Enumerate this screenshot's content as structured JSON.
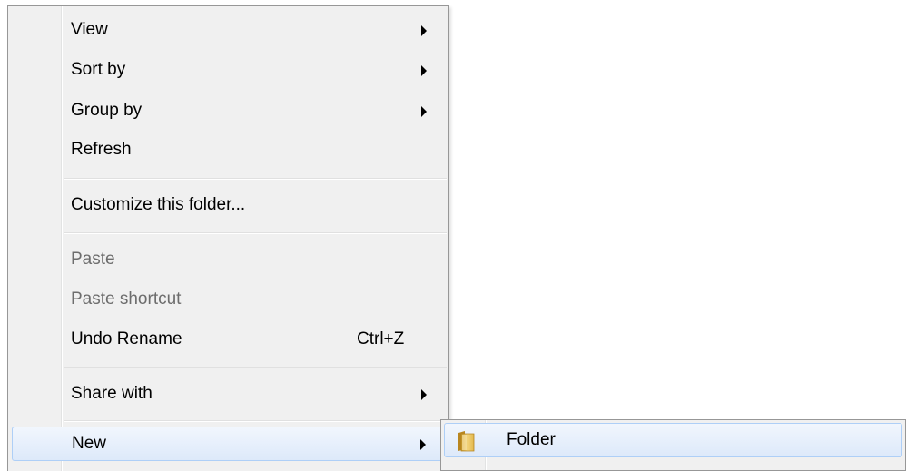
{
  "context_menu": {
    "items": [
      {
        "label": "View",
        "has_submenu": true
      },
      {
        "label": "Sort by",
        "has_submenu": true
      },
      {
        "label": "Group by",
        "has_submenu": true
      },
      {
        "label": "Refresh",
        "has_submenu": false
      },
      {
        "label": "Customize this folder...",
        "has_submenu": false
      },
      {
        "label": "Paste",
        "disabled": true
      },
      {
        "label": "Paste shortcut",
        "disabled": true
      },
      {
        "label": "Undo Rename",
        "shortcut": "Ctrl+Z"
      },
      {
        "label": "Share with",
        "has_submenu": true
      },
      {
        "label": "New",
        "has_submenu": true,
        "highlighted": true
      }
    ]
  },
  "submenu": {
    "items": [
      {
        "label": "Folder",
        "icon": "folder-icon",
        "highlighted": true
      }
    ]
  },
  "colors": {
    "menu_background": "#f0f0f0",
    "highlight": "#dde9fa",
    "highlight_border": "#aecff7",
    "disabled_text": "#6d6d6d"
  }
}
